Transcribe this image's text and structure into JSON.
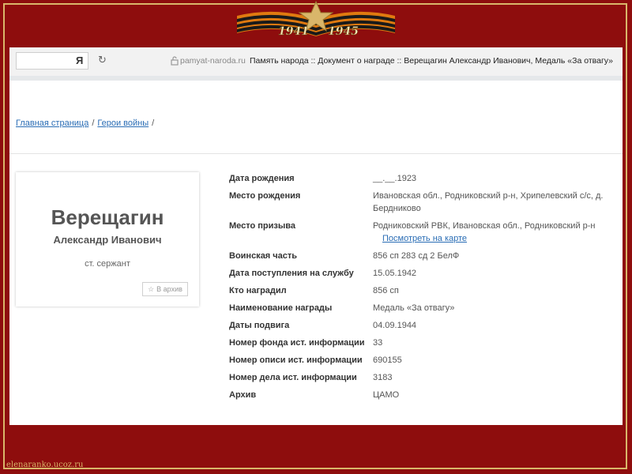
{
  "banner": {
    "years_left": "1941",
    "years_right": "1945"
  },
  "browser": {
    "search_engine_glyph": "Я",
    "reload_glyph": "↻",
    "url": "pamyat-naroda.ru",
    "page_title": "Память народа :: Документ о награде :: Верещагин Александр Иванович, Медаль «За отвагу»"
  },
  "breadcrumb": {
    "items": [
      "Главная страница",
      "Герои войны"
    ],
    "separator": "/"
  },
  "person": {
    "surname": "Верещагин",
    "given_names": "Александр Иванович",
    "rank": "ст. сержант",
    "archive_button": "В архив"
  },
  "details": [
    {
      "label": "Дата рождения",
      "value": "__.__.1923"
    },
    {
      "label": "Место рождения",
      "value": "Ивановская обл., Родниковский р-н, Хрипелевский с/с, д. Бердниково"
    },
    {
      "label": "Место призыва",
      "value": "Родниковский РВК, Ивановская обл., Родниковский р-н",
      "link": "Посмотреть на карте"
    },
    {
      "label": "Воинская часть",
      "value": "856 сп 283 сд 2 БелФ"
    },
    {
      "label": "Дата поступления на службу",
      "value": "15.05.1942"
    },
    {
      "label": "Кто наградил",
      "value": "856 сп"
    },
    {
      "label": "Наименование награды",
      "value": "Медаль «За отвагу»"
    },
    {
      "label": "Даты подвига",
      "value": "04.09.1944"
    },
    {
      "label": "Номер фонда ист. информации",
      "value": "33"
    },
    {
      "label": "Номер описи ист. информации",
      "value": "690155"
    },
    {
      "label": "Номер дела ист. информации",
      "value": "3183"
    },
    {
      "label": "Архив",
      "value": "ЦАМО"
    }
  ],
  "footer": {
    "site": "elenaranko.ucoz.ru"
  },
  "colors": {
    "frame": "#8e0d0d",
    "gold": "#d9b66a",
    "link": "#2a6db5",
    "ribbon_orange": "#e07a10",
    "ribbon_black": "#1a1a1a"
  }
}
